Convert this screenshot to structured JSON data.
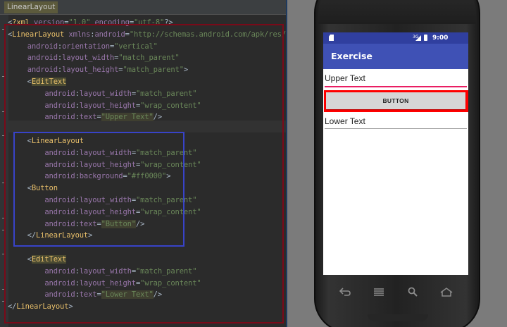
{
  "editor": {
    "breadcrumb": "LinearLayout",
    "lines": [
      "<?xml version=\"1.0\" encoding=\"utf-8\"?>",
      "<LinearLayout xmlns:android=\"http://schemas.android.com/apk/res/android\"",
      "    android:orientation=\"vertical\"",
      "    android:layout_width=\"match_parent\"",
      "    android:layout_height=\"match_parent\">",
      "    <EditText",
      "        android:layout_width=\"match_parent\"",
      "        android:layout_height=\"wrap_content\"",
      "        android:text=\"Upper Text\"/>",
      "",
      "    <LinearLayout",
      "        android:layout_width=\"match_parent\"",
      "        android:layout_height=\"wrap_content\"",
      "        android:background=\"#ff0000\">",
      "    <Button",
      "        android:layout_width=\"match_parent\"",
      "        android:layout_height=\"wrap_content\"",
      "        android:text=\"Button\"/>",
      "    </LinearLayout>",
      "",
      "    <EditText",
      "        android:layout_width=\"match_parent\"",
      "        android:layout_height=\"wrap_content\"",
      "        android:text=\"Lower Text\"/>",
      "</LinearLayout>"
    ]
  },
  "emulator": {
    "clock": "9:00",
    "signal_label": "3G",
    "app_title": "Exercise",
    "upper_text": "Upper Text",
    "button_label": "BUTTON",
    "lower_text": "Lower Text",
    "colors": {
      "status_bar": "#303f9f",
      "app_bar": "#3f51b5",
      "accent_underline": "#e91e63",
      "container_background": "#ff0000",
      "outer_highlight_box": "#7a0a19",
      "inner_highlight_box": "#3843c8"
    },
    "nav_icons": [
      "back-icon",
      "recent-apps-icon",
      "search-icon",
      "home-icon"
    ]
  }
}
